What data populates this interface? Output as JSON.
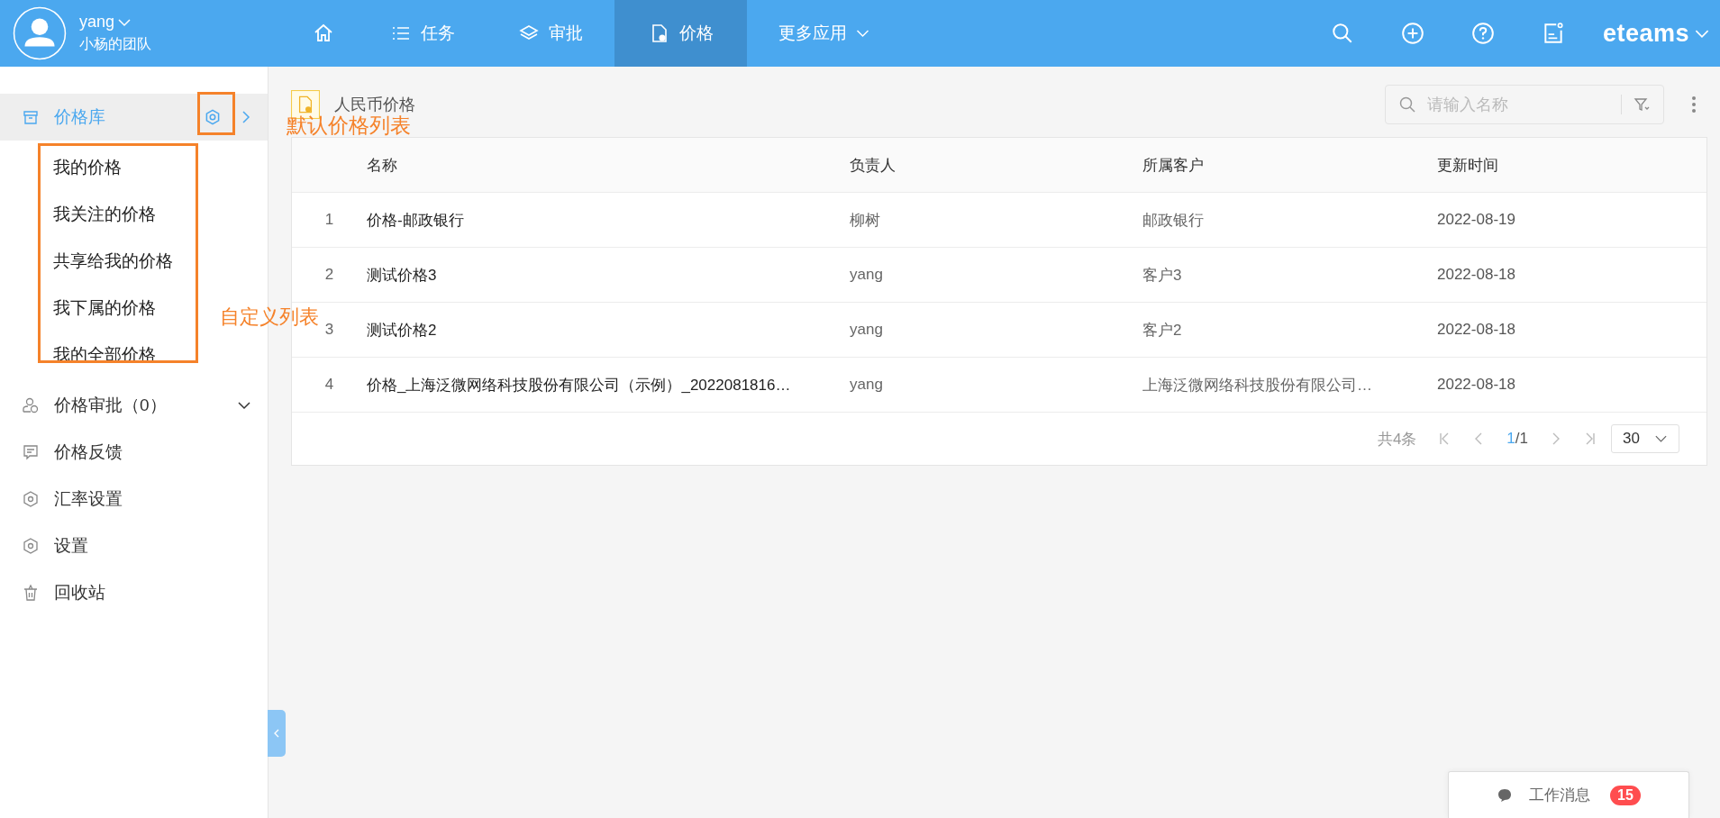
{
  "user": {
    "name": "yang",
    "team": "小杨的团队"
  },
  "nav": [
    {
      "kind": "home",
      "selected": false
    },
    {
      "kind": "list",
      "label": "任务",
      "selected": false
    },
    {
      "kind": "layers",
      "label": "审批",
      "selected": false
    },
    {
      "kind": "doc",
      "label": "价格",
      "selected": true
    },
    {
      "kind": "more",
      "label": "更多应用",
      "selected": false
    }
  ],
  "brand": "eteams",
  "sidebar": {
    "items": [
      {
        "kind": "box",
        "label": "价格库",
        "selected": true,
        "children": [
          {
            "label": "我的价格",
            "selected": false
          },
          {
            "label": "我关注的价格",
            "selected": false
          },
          {
            "label": "共享给我的价格",
            "selected": false
          },
          {
            "label": "我下属的价格",
            "selected": false
          },
          {
            "label": "我的全部价格",
            "selected": false
          }
        ]
      },
      {
        "kind": "approve",
        "label": "价格审批（0）",
        "selected": false
      },
      {
        "kind": "comment",
        "label": "价格反馈",
        "selected": false
      },
      {
        "kind": "hex",
        "label": "汇率设置",
        "selected": false
      },
      {
        "kind": "hex",
        "label": "设置",
        "selected": false
      },
      {
        "kind": "trash",
        "label": "回收站",
        "selected": false
      }
    ]
  },
  "annotations": [
    "默认价格列表",
    "自定义列表"
  ],
  "page": {
    "title": "人民币价格",
    "search": {
      "placeholder": "请输入名称"
    }
  },
  "table": {
    "columns": [
      "名称",
      "负责人",
      "所属客户",
      "更新时间"
    ],
    "rows": [
      {
        "index": "1",
        "name": "价格-邮政银行",
        "owner": "柳树",
        "customer": "邮政银行",
        "updated": "2022-08-19"
      },
      {
        "index": "2",
        "name": "测试价格3",
        "owner": "yang",
        "customer": "客户3",
        "updated": "2022-08-18"
      },
      {
        "index": "3",
        "name": "测试价格2",
        "owner": "yang",
        "customer": "客户2",
        "updated": "2022-08-18"
      },
      {
        "index": "4",
        "name": "价格_上海泛微网络科技股份有限公司（示例）_2022081816…",
        "owner": "yang",
        "customer": "上海泛微网络科技股份有限公司…",
        "updated": "2022-08-18"
      }
    ]
  },
  "pagination": {
    "total": "共4条",
    "current": "1",
    "pages": "/1",
    "page_size": "30"
  },
  "messages": {
    "label": "工作消息",
    "count": "15"
  }
}
